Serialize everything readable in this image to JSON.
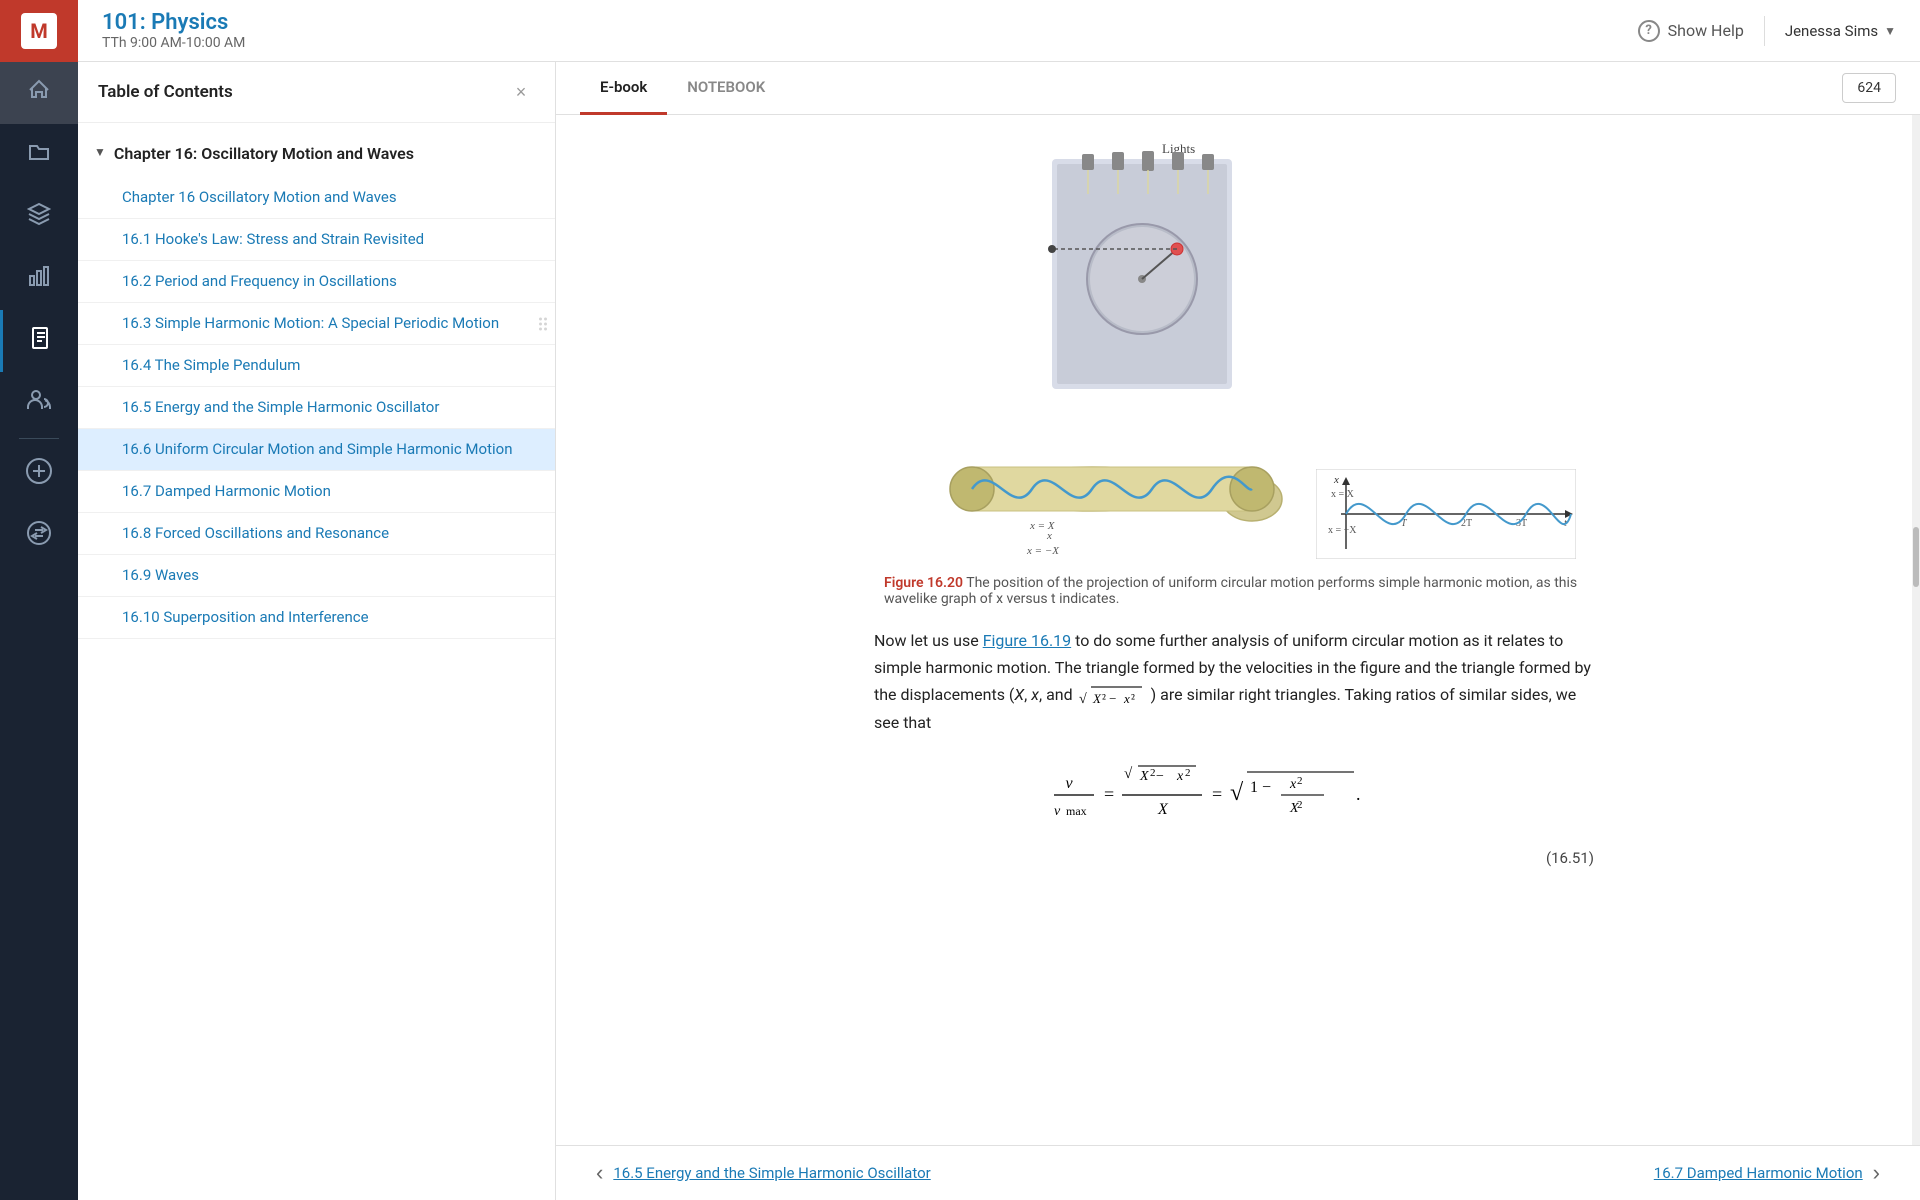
{
  "app": {
    "logo_text": "M"
  },
  "header": {
    "course_title": "101: Physics",
    "course_time": "TTh 9:00 AM-10:00 AM",
    "show_help_label": "Show Help",
    "user_name": "Jenessa Sims"
  },
  "nav": {
    "items": [
      {
        "id": "home",
        "icon": "⌂",
        "label": "Home"
      },
      {
        "id": "folder",
        "icon": "▣",
        "label": "Folder"
      },
      {
        "id": "layers",
        "icon": "◫",
        "label": "Layers"
      },
      {
        "id": "chart",
        "icon": "▦",
        "label": "Chart"
      },
      {
        "id": "notebook",
        "icon": "▤",
        "label": "Notebook"
      },
      {
        "id": "users",
        "icon": "◎",
        "label": "Users"
      },
      {
        "id": "add",
        "icon": "+",
        "label": "Add"
      },
      {
        "id": "swap",
        "icon": "⇄",
        "label": "Swap"
      }
    ]
  },
  "toc": {
    "title": "Table of Contents",
    "close_label": "×",
    "chapter": {
      "title": "Chapter 16: Oscillatory Motion and Waves",
      "items": [
        {
          "id": "ch16-intro",
          "label": "Chapter 16 Oscillatory Motion and Waves",
          "active": false
        },
        {
          "id": "16-1",
          "label": "16.1 Hooke's Law: Stress and Strain Revisited",
          "active": false
        },
        {
          "id": "16-2",
          "label": "16.2 Period and Frequency in Oscillations",
          "active": false
        },
        {
          "id": "16-3",
          "label": "16.3 Simple Harmonic Motion: A Special Periodic Motion",
          "active": false
        },
        {
          "id": "16-4",
          "label": "16.4 The Simple Pendulum",
          "active": false
        },
        {
          "id": "16-5",
          "label": "16.5 Energy and the Simple Harmonic Oscillator",
          "active": false
        },
        {
          "id": "16-6",
          "label": "16.6 Uniform Circular Motion and Simple Harmonic Motion",
          "active": true
        },
        {
          "id": "16-7",
          "label": "16.7 Damped Harmonic Motion",
          "active": false
        },
        {
          "id": "16-8",
          "label": "16.8 Forced Oscillations and Resonance",
          "active": false
        },
        {
          "id": "16-9",
          "label": "16.9 Waves",
          "active": false
        },
        {
          "id": "16-10",
          "label": "16.10 Superposition and Interference",
          "active": false
        }
      ]
    }
  },
  "ebook": {
    "tabs": [
      {
        "id": "ebook",
        "label": "E-book",
        "active": true
      },
      {
        "id": "notebook",
        "label": "NOTEBOOK",
        "active": false
      }
    ],
    "page_number": "624",
    "figure": {
      "number": "Figure 16.20",
      "caption": "The position of the projection of uniform circular motion performs simple harmonic motion, as this wavelike graph of x versus t indicates."
    },
    "body_text": "Now let us use Figure 16.19 to do some further analysis of uniform circular motion as it relates to simple harmonic motion. The triangle formed by the velocities in the figure and the triangle formed by the displacements (X, x, and √X² − x²) are similar right triangles. Taking ratios of similar sides, we see that",
    "equation_label": "(16.51)",
    "bottom_nav": {
      "prev_label": "16.5 Energy and the Simple Harmonic Oscillator",
      "next_label": "16.7 Damped Harmonic Motion"
    }
  }
}
